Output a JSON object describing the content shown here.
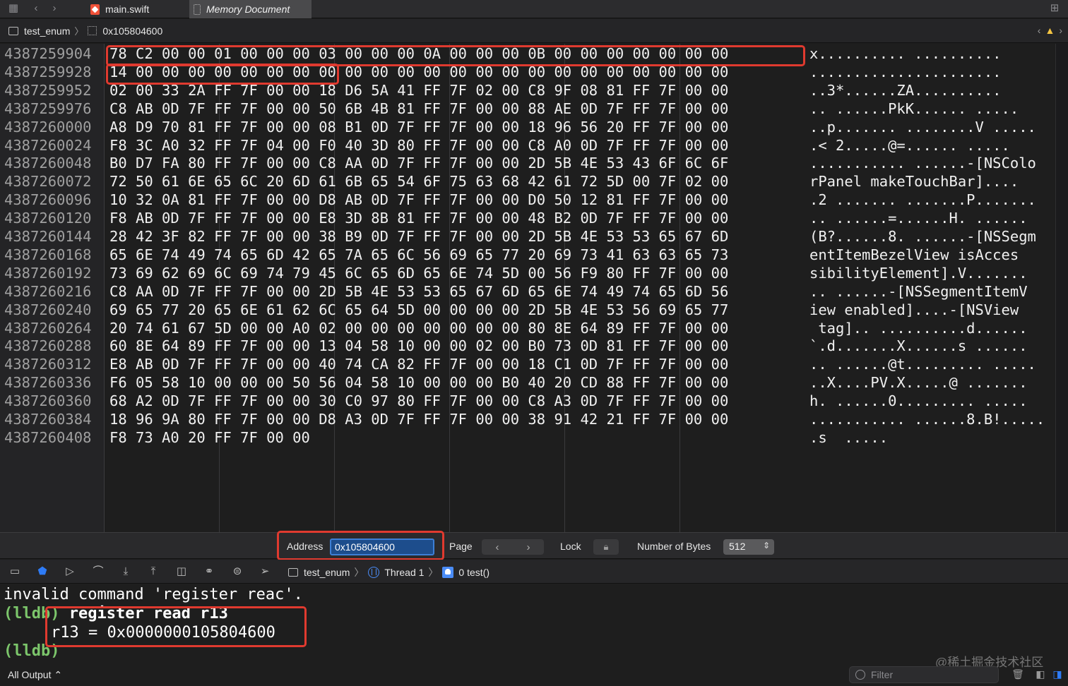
{
  "tabs": [
    {
      "label": "main.swift"
    },
    {
      "label": "Memory Document"
    }
  ],
  "jumpbar": {
    "target": "test_enum",
    "address": "0x105804600"
  },
  "memory": {
    "addresses": [
      "4387259904",
      "4387259928",
      "4387259952",
      "4387259976",
      "4387260000",
      "4387260024",
      "4387260048",
      "4387260072",
      "4387260096",
      "4387260120",
      "4387260144",
      "4387260168",
      "4387260192",
      "4387260216",
      "4387260240",
      "4387260264",
      "4387260288",
      "4387260312",
      "4387260336",
      "4387260360",
      "4387260384",
      "4387260408"
    ],
    "hex": [
      "78 C2 00 00 01 00 00 00 03 00 00 00 0A 00 00 00 0B 00 00 00 00 00 00 00",
      "14 00 00 00 00 00 00 00 00 00 00 00 00 00 00 00 00 00 00 00 00 00 00 00",
      "02 00 33 2A FF 7F 00 00 18 D6 5A 41 FF 7F 02 00 C8 9F 08 81 FF 7F 00 00",
      "C8 AB 0D 7F FF 7F 00 00 50 6B 4B 81 FF 7F 00 00 88 AE 0D 7F FF 7F 00 00",
      "A8 D9 70 81 FF 7F 00 00 08 B1 0D 7F FF 7F 00 00 18 96 56 20 FF 7F 00 00",
      "F8 3C A0 32 FF 7F 04 00 F0 40 3D 80 FF 7F 00 00 C8 A0 0D 7F FF 7F 00 00",
      "B0 D7 FA 80 FF 7F 00 00 C8 AA 0D 7F FF 7F 00 00 2D 5B 4E 53 43 6F 6C 6F",
      "72 50 61 6E 65 6C 20 6D 61 6B 65 54 6F 75 63 68 42 61 72 5D 00 7F 02 00",
      "10 32 0A 81 FF 7F 00 00 D8 AB 0D 7F FF 7F 00 00 D0 50 12 81 FF 7F 00 00",
      "F8 AB 0D 7F FF 7F 00 00 E8 3D 8B 81 FF 7F 00 00 48 B2 0D 7F FF 7F 00 00",
      "28 42 3F 82 FF 7F 00 00 38 B9 0D 7F FF 7F 00 00 2D 5B 4E 53 53 65 67 6D",
      "65 6E 74 49 74 65 6D 42 65 7A 65 6C 56 69 65 77 20 69 73 41 63 63 65 73",
      "73 69 62 69 6C 69 74 79 45 6C 65 6D 65 6E 74 5D 00 56 F9 80 FF 7F 00 00",
      "C8 AA 0D 7F FF 7F 00 00 2D 5B 4E 53 53 65 67 6D 65 6E 74 49 74 65 6D 56",
      "69 65 77 20 65 6E 61 62 6C 65 64 5D 00 00 00 00 2D 5B 4E 53 56 69 65 77",
      "20 74 61 67 5D 00 00 A0 02 00 00 00 00 00 00 00 80 8E 64 89 FF 7F 00 00",
      "60 8E 64 89 FF 7F 00 00 13 04 58 10 00 00 02 00 B0 73 0D 81 FF 7F 00 00",
      "E8 AB 0D 7F FF 7F 00 00 40 74 CA 82 FF 7F 00 00 18 C1 0D 7F FF 7F 00 00",
      "F6 05 58 10 00 00 00 50 56 04 58 10 00 00 00 B0 40 20 CD 88 FF 7F 00 00",
      "68 A2 0D 7F FF 7F 00 00 30 C0 97 80 FF 7F 00 00 C8 A3 0D 7F FF 7F 00 00",
      "18 96 9A 80 FF 7F 00 00 D8 A3 0D 7F FF 7F 00 00 38 91 42 21 FF 7F 00 00",
      "F8 73 A0 20 FF 7F 00 00"
    ],
    "ascii": [
      "x.......... ..........",
      "......................",
      "..3*......ZA..........",
      ".. ......PkK...... .....",
      "..p....... ........V .....",
      ".< 2.....@=...... .....",
      "........... ......-[NSColo",
      "rPanel makeTouchBar]....",
      ".2 ....... .......P.......",
      ".. ......=......H. ......",
      "(B?......8. ......-[NSSegm",
      "entItemBezelView isAcces",
      "sibilityElement].V.......",
      ".. ......-[NSSegmentItemV",
      "iew enabled]....-[NSView",
      " tag].. ..........d......",
      "`.d.......X......s ......",
      ".. ......@t......... .....",
      "..X....PV.X.....@ .......",
      "h. ......0......... .....",
      "........... ......8.B!.....",
      ".s  ....."
    ]
  },
  "memory_bar": {
    "address_label": "Address",
    "address_value": "0x105804600",
    "page_label": "Page",
    "lock_label": "Lock",
    "bytes_label": "Number of Bytes",
    "bytes_value": "512"
  },
  "debug_bar": {
    "target": "test_enum",
    "thread": "Thread 1",
    "frame": "0 test()"
  },
  "console": {
    "line1": "invalid command 'register reac'.",
    "prompt": "(lldb)",
    "command": " register read r13",
    "result": "r13 = 0x0000000105804600"
  },
  "status": {
    "output_selector": "All Output ⌃",
    "filter_placeholder": "Filter",
    "watermark": "@稀土掘金技术社区"
  },
  "colors": {
    "highlight_box": "#e03a2f",
    "lldb_prompt": "#7cc66b",
    "accent": "#2e7bf6"
  }
}
